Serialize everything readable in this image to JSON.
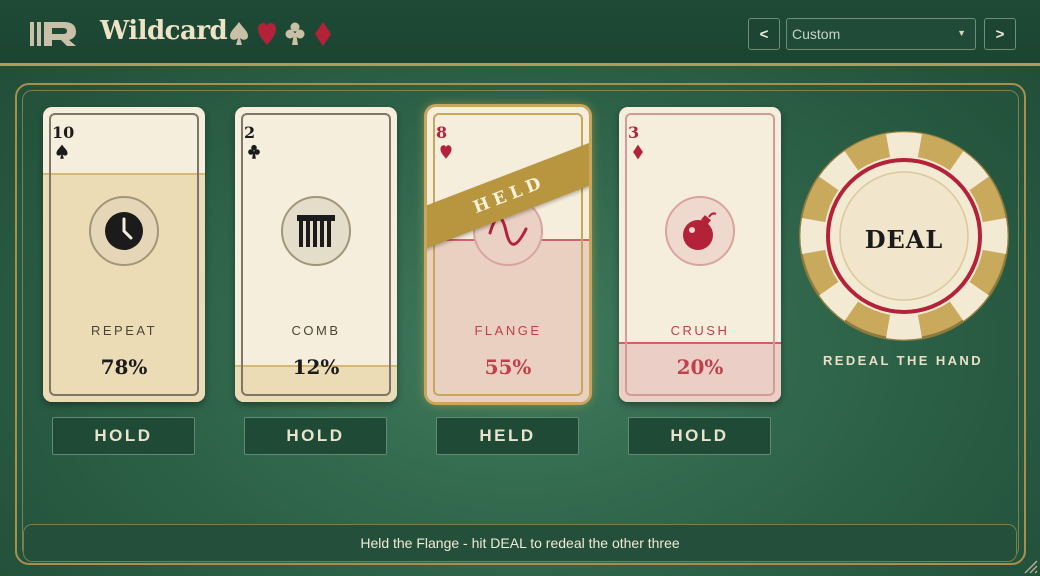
{
  "app": {
    "brand": "Wildcard",
    "logo_icon": "r-logo-icon",
    "suits": [
      "spade-icon",
      "heart-icon",
      "club-icon",
      "diamond-icon"
    ]
  },
  "header": {
    "prev_label": "<",
    "next_label": ">",
    "preset": {
      "value": "Custom",
      "icon": "chevron-down-icon"
    }
  },
  "colors": {
    "felt": "#2e6449",
    "header": "#1e4a36",
    "gold": "#b59a55",
    "card": "#f6eedc",
    "red": "#b32239",
    "ink": "#1b1b1b"
  },
  "cards": [
    {
      "rank": "10",
      "suit": "spade-icon",
      "effect": "REPEAT",
      "percent": "78%",
      "level": 0.78,
      "icon": "clock-icon",
      "hold_label": "HOLD",
      "held": false
    },
    {
      "rank": "2",
      "suit": "club-icon",
      "effect": "COMB",
      "percent": "12%",
      "level": 0.12,
      "icon": "comb-icon",
      "hold_label": "HOLD",
      "held": false
    },
    {
      "rank": "8",
      "suit": "heart-icon",
      "effect": "FLANGE",
      "percent": "55%",
      "level": 0.55,
      "icon": "wave-icon",
      "hold_label": "HELD",
      "held": true,
      "ribbon": "HELD"
    },
    {
      "rank": "3",
      "suit": "diamond-icon",
      "effect": "CRUSH",
      "percent": "20%",
      "level": 0.2,
      "icon": "bomb-icon",
      "hold_label": "HOLD",
      "held": false
    }
  ],
  "deal": {
    "label": "DEAL",
    "caption": "REDEAL THE HAND"
  },
  "status": {
    "message": "Held the Flange - hit DEAL to redeal the other three"
  }
}
